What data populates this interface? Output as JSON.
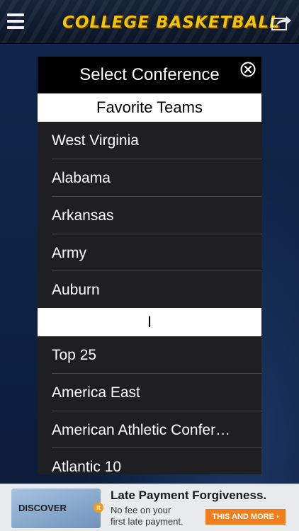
{
  "app": {
    "title": "College Basketball",
    "title_display": "COLLEGE BASKETBALL",
    "accent_color": "#f5c400"
  },
  "modal": {
    "title": "Select Conference",
    "sections": [
      {
        "header": "Favorite Teams",
        "items": [
          "West Virginia",
          "Alabama",
          "Arkansas",
          "Army",
          "Auburn"
        ]
      },
      {
        "header": "I",
        "items": [
          "Top 25",
          "America East",
          "American Athletic Confer…",
          "Atlantic 10"
        ]
      }
    ]
  },
  "ad": {
    "card_logo": "DISCOVER",
    "card_badge": "it",
    "headline": "Late Payment Forgiveness.",
    "line1": "No fee on your",
    "line2": "first late payment.",
    "cta": "THIS AND MORE ›",
    "cta_color": "#f07e1d"
  },
  "icons": {
    "menu": "hamburger-menu-icon",
    "share": "share-icon",
    "close": "close-circle-icon"
  }
}
